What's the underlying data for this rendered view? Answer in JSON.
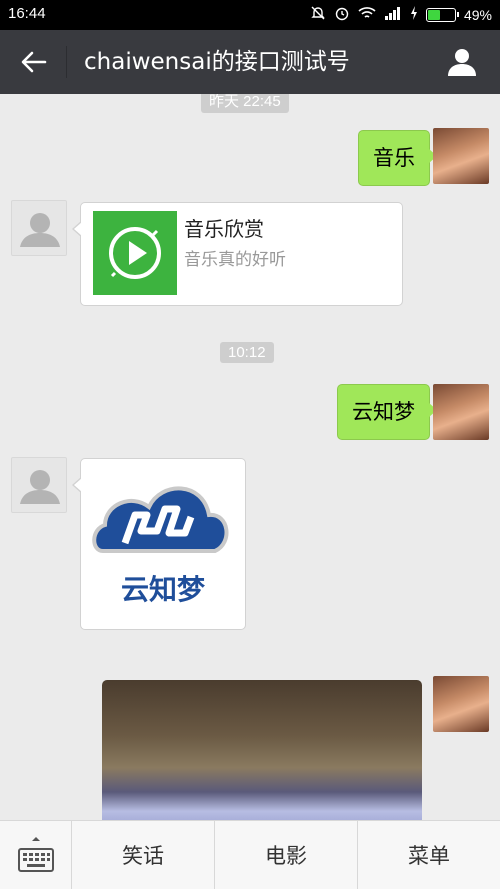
{
  "status_bar": {
    "time": "16:44",
    "battery_text": "49%",
    "battery_level": 0.49,
    "icons": [
      "mute-icon",
      "alarm-icon",
      "wifi-icon",
      "signal-icon",
      "charging-icon",
      "battery-icon"
    ]
  },
  "header": {
    "title": "chaiwensai的接口测试号",
    "back_icon": "back-arrow-icon",
    "profile_icon": "person-icon"
  },
  "messages": {
    "timestamp_1": "昨天 22:45",
    "sent_1": "音乐",
    "music_card": {
      "title": "音乐欣赏",
      "description": "音乐真的好听",
      "icon": "music-play-icon"
    },
    "timestamp_2": "10:12",
    "sent_2": "云知梦",
    "logo_text": "云知梦"
  },
  "bottom_menu": {
    "keyboard_icon": "keyboard-icon",
    "items": [
      {
        "label": "笑话"
      },
      {
        "label": "电影"
      },
      {
        "label": "菜单"
      }
    ]
  },
  "colors": {
    "header_bg": "#393a3f",
    "sent_bubble": "#a0e759",
    "chat_bg": "#ebebeb",
    "logo_blue": "#1f4e9a"
  }
}
